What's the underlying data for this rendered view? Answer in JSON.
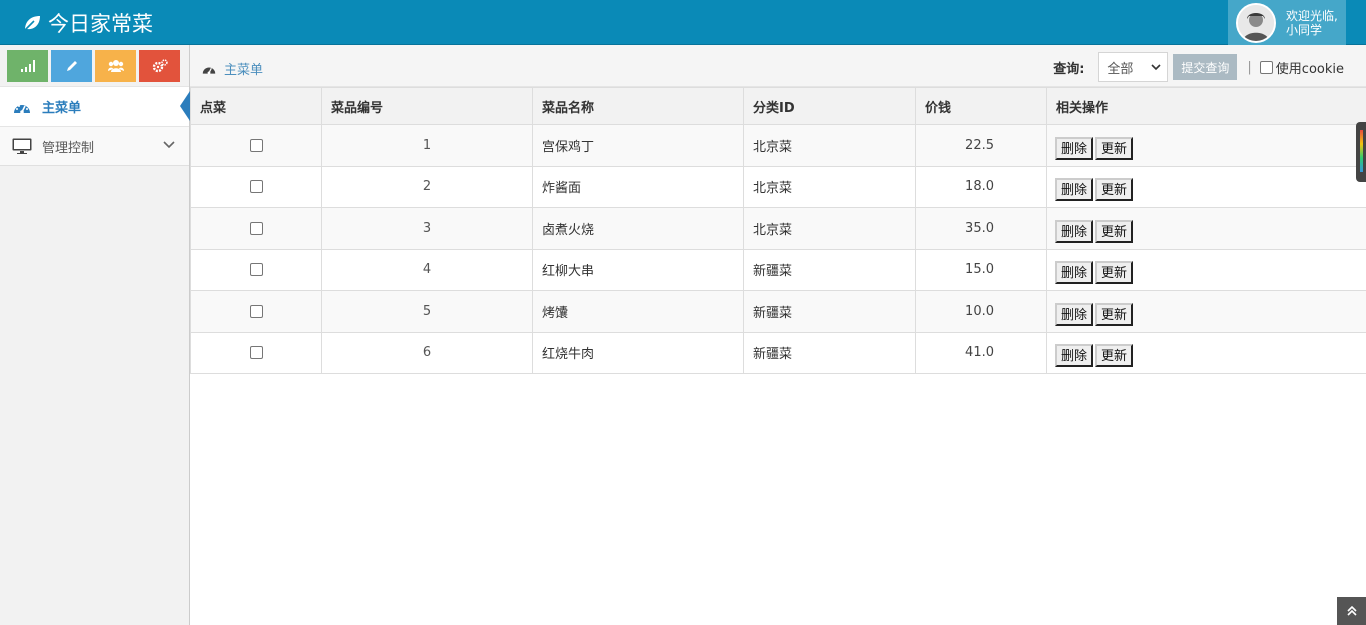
{
  "app": {
    "title": "今日家常菜"
  },
  "user": {
    "welcome": "欢迎光临,",
    "name": "小同学"
  },
  "sidebar": {
    "shortcuts": [
      {
        "icon": "signal-icon",
        "color": "#6fb36a"
      },
      {
        "icon": "pencil-icon",
        "color": "#4fa6dd"
      },
      {
        "icon": "group-icon",
        "color": "#f7b24a"
      },
      {
        "icon": "cogs-icon",
        "color": "#e2533c"
      }
    ],
    "items": [
      {
        "label": "主菜单",
        "icon": "dashboard-icon",
        "active": true
      },
      {
        "label": "管理控制",
        "icon": "desktop-icon",
        "active": false
      }
    ]
  },
  "breadcrumb": {
    "label": "主菜单"
  },
  "query": {
    "label": "查询:",
    "select_value": "全部",
    "submit_label": "提交查询",
    "separator": "|",
    "cookie_label": "使用cookie"
  },
  "table": {
    "headers": [
      "点菜",
      "菜品编号",
      "菜品名称",
      "分类ID",
      "价钱",
      "相关操作"
    ],
    "delete_label": "删除",
    "update_label": "更新",
    "rows": [
      {
        "id": "1",
        "name": "宫保鸡丁",
        "category": "北京菜",
        "price": "22.5"
      },
      {
        "id": "2",
        "name": "炸酱面",
        "category": "北京菜",
        "price": "18.0"
      },
      {
        "id": "3",
        "name": "卤煮火烧",
        "category": "北京菜",
        "price": "35.0"
      },
      {
        "id": "4",
        "name": "红柳大串",
        "category": "新疆菜",
        "price": "15.0"
      },
      {
        "id": "5",
        "name": "烤馕",
        "category": "新疆菜",
        "price": "10.0"
      },
      {
        "id": "6",
        "name": "红烧牛肉",
        "category": "新疆菜",
        "price": "41.0"
      }
    ]
  }
}
